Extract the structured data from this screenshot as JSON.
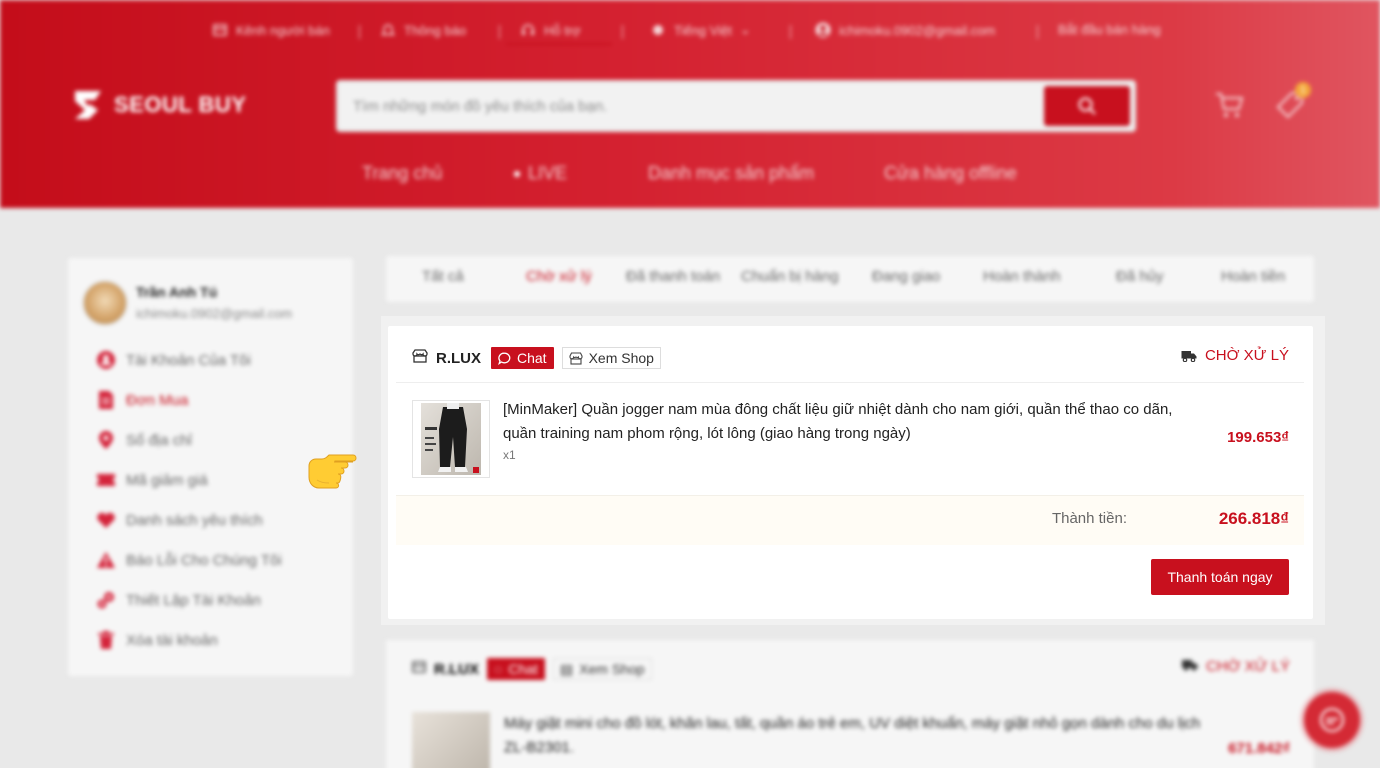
{
  "topbar": {
    "seller_channel": "Kênh người bán",
    "notifications": "Thông báo",
    "support": "Hỗ trợ",
    "language": "Tiếng Việt",
    "account_email": "ichimoku.0902@gmail.com",
    "start_selling": "Bắt đầu bán hàng"
  },
  "header": {
    "logo_text": "SEOUL BUY",
    "search_placeholder": "Tìm những món đồ yêu thích của bạn.",
    "notification_badge": "1"
  },
  "nav": {
    "items": [
      "Trang chủ",
      "LIVE",
      "Danh mục sản phẩm",
      "Cửa hàng offline"
    ]
  },
  "user": {
    "name": "Trần Anh Tú",
    "email": "ichimoku.0902@gmail.com"
  },
  "sidebar": {
    "items": [
      {
        "label": "Tài Khoản Của Tôi",
        "icon": "user-icon"
      },
      {
        "label": "Đơn Mua",
        "icon": "order-icon"
      },
      {
        "label": "Sổ địa chỉ",
        "icon": "location-icon"
      },
      {
        "label": "Mã giảm giá",
        "icon": "voucher-icon"
      },
      {
        "label": "Danh sách yêu thích",
        "icon": "heart-icon"
      },
      {
        "label": "Báo Lỗi Cho Chúng Tôi",
        "icon": "warning-icon"
      },
      {
        "label": "Thiết Lập Tài Khoản",
        "icon": "settings-icon"
      },
      {
        "label": "Xóa tài khoản",
        "icon": "trash-icon"
      }
    ],
    "active_index": 1
  },
  "tabs": {
    "items": [
      "Tất cả",
      "Chờ xử lý",
      "Đã thanh toán",
      "Chuẩn bị hàng",
      "Đang giao",
      "Hoàn thành",
      "Đã hủy",
      "Hoàn tiền"
    ],
    "active_index": 1
  },
  "order": {
    "shop_name": "R.LUX",
    "chat_label": "Chat",
    "view_shop_label": "Xem Shop",
    "status": "CHỜ XỬ LÝ",
    "product_title": "[MinMaker] Quần jogger nam mùa đông chất liệu giữ nhiệt dành cho nam giới, quần thể thao co dãn, quần training nam phom rộng, lót lông (giao hàng trong ngày)",
    "quantity": "x1",
    "price": "199.653₫",
    "total_label": "Thành tiền:",
    "total_value": "266.818₫",
    "pay_button": "Thanh toán ngay"
  },
  "order2": {
    "shop_name": "R.LUX",
    "chat_label": "Chat",
    "view_shop_label": "Xem Shop",
    "status": "CHỜ XỬ LÝ",
    "product_title": "Máy giặt mini cho đồ lót, khăn lau, tất, quần áo trẻ em, UV diệt khuẩn, máy giặt nhỏ gọn dành cho du lịch ZL-B2301.",
    "price": "671.842₫"
  },
  "colors": {
    "brand_red": "#c8101e",
    "header_gradient_end": "#e05560",
    "background": "#e9e9e9"
  }
}
